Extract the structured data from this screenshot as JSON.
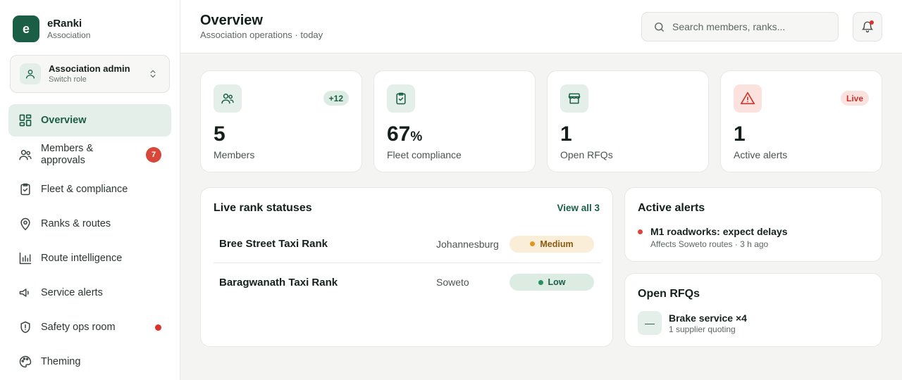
{
  "brand": {
    "logo_letter": "e",
    "name": "eRanki",
    "subtitle": "Association"
  },
  "role": {
    "title": "Association admin",
    "subtitle": "Switch role"
  },
  "nav": [
    {
      "label": "Overview",
      "icon": "grid-icon",
      "active": true
    },
    {
      "label": "Members & approvals",
      "icon": "users-icon",
      "badge": "7"
    },
    {
      "label": "Fleet & compliance",
      "icon": "clipboard-check-icon"
    },
    {
      "label": "Ranks & routes",
      "icon": "map-pin-icon"
    },
    {
      "label": "Route intelligence",
      "icon": "bar-chart-icon"
    },
    {
      "label": "Service alerts",
      "icon": "megaphone-icon"
    },
    {
      "label": "Safety ops room",
      "icon": "shield-icon",
      "dot": "red"
    },
    {
      "label": "Theming",
      "icon": "palette-icon"
    }
  ],
  "header": {
    "title": "Overview",
    "subtitle": "Association operations · today",
    "search_placeholder": "Search members, ranks..."
  },
  "stats": [
    {
      "value": "5",
      "unit": "",
      "label": "Members",
      "pill": "+12",
      "icon": "users-icon"
    },
    {
      "value": "67",
      "unit": "%",
      "label": "Fleet compliance",
      "pill": "",
      "icon": "clipboard-check-icon"
    },
    {
      "value": "1",
      "unit": "",
      "label": "Open RFQs",
      "pill": "",
      "icon": "store-icon"
    },
    {
      "value": "1",
      "unit": "",
      "label": "Active alerts",
      "pill": "Live",
      "icon": "alert-triangle-icon"
    }
  ],
  "ranks": {
    "title": "Live rank statuses",
    "view_all": "View all 3",
    "rows": [
      {
        "name": "Bree Street Taxi Rank",
        "city": "Johannesburg",
        "status": "Medium"
      },
      {
        "name": "Baragwanath Taxi Rank",
        "city": "Soweto",
        "status": "Low"
      }
    ]
  },
  "alerts": {
    "title": "Active alerts",
    "items": [
      {
        "title": "M1 roadworks: expect delays",
        "meta": "Affects Soweto routes · 3 h ago"
      }
    ]
  },
  "rfqs": {
    "title": "Open RFQs",
    "items": [
      {
        "icon_glyph": "—",
        "title": "Brake service ×4",
        "meta": "1 supplier quoting"
      }
    ]
  },
  "colors": {
    "brand": "#1a5e46",
    "accent_light": "#e3efe8",
    "danger": "#d9463a",
    "warning": "#e2961f"
  }
}
